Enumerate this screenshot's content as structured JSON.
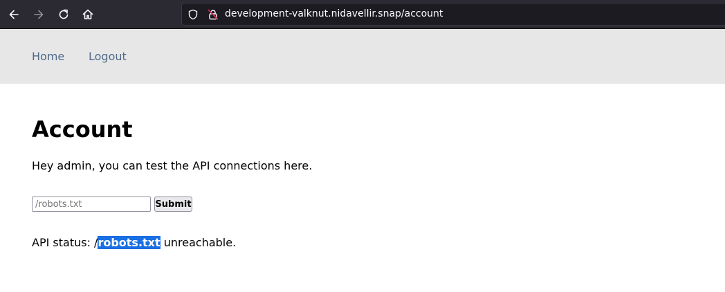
{
  "browser": {
    "url": "development-valknut.nidavellir.snap/account",
    "icons": [
      "back-arrow-icon",
      "forward-arrow-icon",
      "reload-icon",
      "home-icon",
      "shield-icon",
      "insecure-lock-icon"
    ],
    "chrome_color": "#2b2a33"
  },
  "nav": {
    "home_label": "Home",
    "logout_label": "Logout",
    "link_color": "#4e6a88",
    "bar_color": "#e7e7e7"
  },
  "main": {
    "title": "Account",
    "intro": "Hey admin, you can test the API connections here.",
    "input_placeholder": "/robots.txt",
    "input_value": "",
    "submit_label": "Submit",
    "status_prefix": "API status: /",
    "status_highlight": "robots.txt",
    "status_suffix": " unreachable.",
    "highlight_color": "#1a6fe4"
  }
}
